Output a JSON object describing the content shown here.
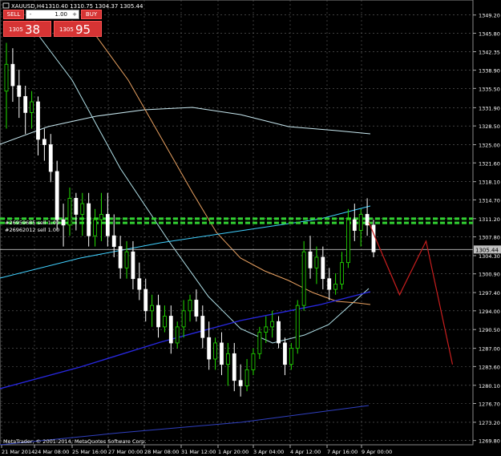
{
  "header": {
    "symbol": "XAUUSD,H4",
    "ohlc": "1310.40 1310.75 1304.37 1305.44"
  },
  "trade_panel": {
    "sell_label": "SELL",
    "buy_label": "BUY",
    "lot_value": "1.00",
    "minus": "-",
    "plus": "+",
    "bid_prefix": "1305",
    "bid_big": "38",
    "ask_prefix": "1305",
    "ask_big": "95"
  },
  "orders": [
    "#26959685 sell 1.00",
    "#26962012 sell 1.00"
  ],
  "current_price_label": "1305.44",
  "copyright": "MetaTrader, © 2001-2014, MetaQuotes Software Corp.",
  "colors": {
    "background": "#000000",
    "grid": "#646464",
    "candle_bull": "#22e000",
    "candle_bear": "#ffffff",
    "order_line": "#32d232",
    "price_line": "#c0c0c0",
    "projection": "#c81e1e",
    "ma_fast": "#e8a060",
    "ma_mid": "#b0e0e8",
    "ma_slow": "#c8e8f0",
    "trend_upper": "#40d0ff",
    "trend_lower": "#2828e0",
    "trend_bottom": "#3040c0"
  },
  "chart_data": {
    "type": "candlestick",
    "y_ticks": [
      "1349.20",
      "1345.80",
      "1342.35",
      "1338.90",
      "1335.50",
      "1331.90",
      "1328.50",
      "1325.00",
      "1321.60",
      "1318.10",
      "1314.70",
      "1311.20",
      "1307.80",
      "1304.30",
      "1300.90",
      "1297.40",
      "1294.00",
      "1290.50",
      "1287.00",
      "1283.60",
      "1280.10",
      "1276.70",
      "1273.20",
      "1269.80"
    ],
    "x_ticks": [
      "21 Mar 2014",
      "24 Mar 08:00",
      "25 Mar 16:00",
      "27 Mar 00:00",
      "28 Mar 08:00",
      "31 Mar 12:00",
      "1 Apr 20:00",
      "3 Apr 04:00",
      "4 Apr 12:00",
      "7 Apr 16:00",
      "9 Apr 00:00"
    ],
    "ylim": [
      1269.0,
      1352.0
    ],
    "order_levels": [
      1311.2,
      1310.4
    ],
    "current_price": 1305.44,
    "candles": [
      {
        "o": 1335,
        "h": 1344,
        "l": 1328,
        "c": 1340
      },
      {
        "o": 1340,
        "h": 1343,
        "l": 1333,
        "c": 1336
      },
      {
        "o": 1336,
        "h": 1339,
        "l": 1330,
        "c": 1334
      },
      {
        "o": 1334,
        "h": 1336,
        "l": 1327,
        "c": 1331
      },
      {
        "o": 1331,
        "h": 1335,
        "l": 1328,
        "c": 1333
      },
      {
        "o": 1333,
        "h": 1334,
        "l": 1323,
        "c": 1326
      },
      {
        "o": 1326,
        "h": 1328,
        "l": 1322,
        "c": 1325
      },
      {
        "o": 1325,
        "h": 1327,
        "l": 1318,
        "c": 1320
      },
      {
        "o": 1320,
        "h": 1322,
        "l": 1309,
        "c": 1311
      },
      {
        "o": 1311,
        "h": 1314,
        "l": 1306,
        "c": 1310
      },
      {
        "o": 1310,
        "h": 1317,
        "l": 1308,
        "c": 1315
      },
      {
        "o": 1315,
        "h": 1316,
        "l": 1309,
        "c": 1312
      },
      {
        "o": 1312,
        "h": 1316,
        "l": 1308,
        "c": 1314
      },
      {
        "o": 1314,
        "h": 1316,
        "l": 1306,
        "c": 1308
      },
      {
        "o": 1308,
        "h": 1313,
        "l": 1306,
        "c": 1311
      },
      {
        "o": 1311,
        "h": 1316,
        "l": 1307,
        "c": 1312
      },
      {
        "o": 1312,
        "h": 1316,
        "l": 1306,
        "c": 1308
      },
      {
        "o": 1308,
        "h": 1312,
        "l": 1304,
        "c": 1306
      },
      {
        "o": 1306,
        "h": 1308,
        "l": 1300,
        "c": 1302
      },
      {
        "o": 1302,
        "h": 1307,
        "l": 1300,
        "c": 1305
      },
      {
        "o": 1305,
        "h": 1307,
        "l": 1298,
        "c": 1300
      },
      {
        "o": 1300,
        "h": 1303,
        "l": 1296,
        "c": 1298
      },
      {
        "o": 1298,
        "h": 1300,
        "l": 1292,
        "c": 1294
      },
      {
        "o": 1294,
        "h": 1297,
        "l": 1291,
        "c": 1295
      },
      {
        "o": 1295,
        "h": 1297,
        "l": 1289,
        "c": 1291
      },
      {
        "o": 1291,
        "h": 1295,
        "l": 1290,
        "c": 1293
      },
      {
        "o": 1293,
        "h": 1295,
        "l": 1286,
        "c": 1288
      },
      {
        "o": 1288,
        "h": 1292,
        "l": 1287,
        "c": 1291
      },
      {
        "o": 1291,
        "h": 1296,
        "l": 1289,
        "c": 1294
      },
      {
        "o": 1294,
        "h": 1297,
        "l": 1292,
        "c": 1296
      },
      {
        "o": 1296,
        "h": 1298,
        "l": 1292,
        "c": 1293
      },
      {
        "o": 1293,
        "h": 1295,
        "l": 1287,
        "c": 1289
      },
      {
        "o": 1289,
        "h": 1292,
        "l": 1283,
        "c": 1285
      },
      {
        "o": 1285,
        "h": 1289,
        "l": 1283,
        "c": 1288
      },
      {
        "o": 1288,
        "h": 1290,
        "l": 1282,
        "c": 1284
      },
      {
        "o": 1284,
        "h": 1288,
        "l": 1280,
        "c": 1286
      },
      {
        "o": 1286,
        "h": 1288,
        "l": 1279,
        "c": 1281
      },
      {
        "o": 1281,
        "h": 1284,
        "l": 1278,
        "c": 1280
      },
      {
        "o": 1280,
        "h": 1285,
        "l": 1279,
        "c": 1283
      },
      {
        "o": 1283,
        "h": 1287,
        "l": 1282,
        "c": 1286
      },
      {
        "o": 1286,
        "h": 1291,
        "l": 1285,
        "c": 1290
      },
      {
        "o": 1290,
        "h": 1293,
        "l": 1288,
        "c": 1291
      },
      {
        "o": 1291,
        "h": 1294,
        "l": 1289,
        "c": 1292
      },
      {
        "o": 1292,
        "h": 1293,
        "l": 1287,
        "c": 1288
      },
      {
        "o": 1288,
        "h": 1289,
        "l": 1282,
        "c": 1284
      },
      {
        "o": 1284,
        "h": 1288,
        "l": 1283,
        "c": 1287
      },
      {
        "o": 1287,
        "h": 1296,
        "l": 1286,
        "c": 1295
      },
      {
        "o": 1295,
        "h": 1307,
        "l": 1294,
        "c": 1305
      },
      {
        "o": 1305,
        "h": 1308,
        "l": 1300,
        "c": 1302
      },
      {
        "o": 1302,
        "h": 1306,
        "l": 1299,
        "c": 1304
      },
      {
        "o": 1304,
        "h": 1306,
        "l": 1298,
        "c": 1300
      },
      {
        "o": 1300,
        "h": 1302,
        "l": 1296,
        "c": 1298
      },
      {
        "o": 1298,
        "h": 1301,
        "l": 1297,
        "c": 1299
      },
      {
        "o": 1299,
        "h": 1305,
        "l": 1298,
        "c": 1303
      },
      {
        "o": 1303,
        "h": 1313,
        "l": 1302,
        "c": 1311
      },
      {
        "o": 1311,
        "h": 1314,
        "l": 1307,
        "c": 1309
      },
      {
        "o": 1309,
        "h": 1313,
        "l": 1306,
        "c": 1312
      },
      {
        "o": 1312,
        "h": 1315,
        "l": 1308,
        "c": 1310
      },
      {
        "o": 1310,
        "h": 1311,
        "l": 1304,
        "c": 1305
      }
    ],
    "projection_points": [
      [
        1310.5,
        0
      ],
      [
        1297.0,
        7
      ],
      [
        1307.0,
        13
      ],
      [
        1284.0,
        19
      ]
    ]
  }
}
